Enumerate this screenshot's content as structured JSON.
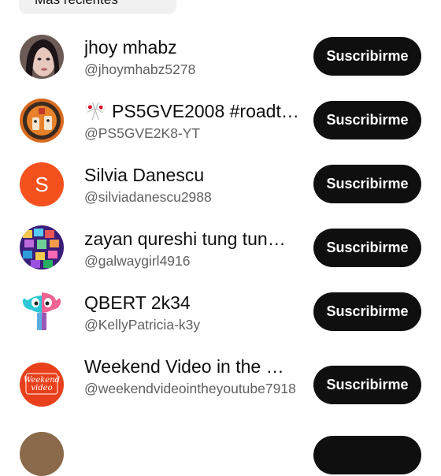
{
  "filter": {
    "label": "Más recientes"
  },
  "subscribe_label": "Suscribirme",
  "channels": [
    {
      "name": "jhoy mhabz",
      "handle": "@jhoymhabz5278",
      "avatar_icon": "photo-avatar-icon"
    },
    {
      "name": "🎌 PS5GVE2008 #roadt…",
      "handle": "@PS5GVE2K8-YT",
      "avatar_icon": "cartoon-avatar-icon"
    },
    {
      "name": "Silvia Danescu",
      "handle": "@silviadanescu2988",
      "avatar_letter": "S",
      "avatar_color": "#f4511e"
    },
    {
      "name": "zayan qureshi tung tun…",
      "handle": "@galwaygirl4916",
      "avatar_icon": "collage-avatar-icon"
    },
    {
      "name": "QBERT 2k34",
      "handle": "@KellyPatricia-k3y",
      "avatar_icon": "character-avatar-icon"
    },
    {
      "name": "Weekend Video in the …",
      "handle": "@weekendvideointheyoutube7918",
      "avatar_text": "Weekend video",
      "avatar_color": "#e8401c"
    }
  ]
}
